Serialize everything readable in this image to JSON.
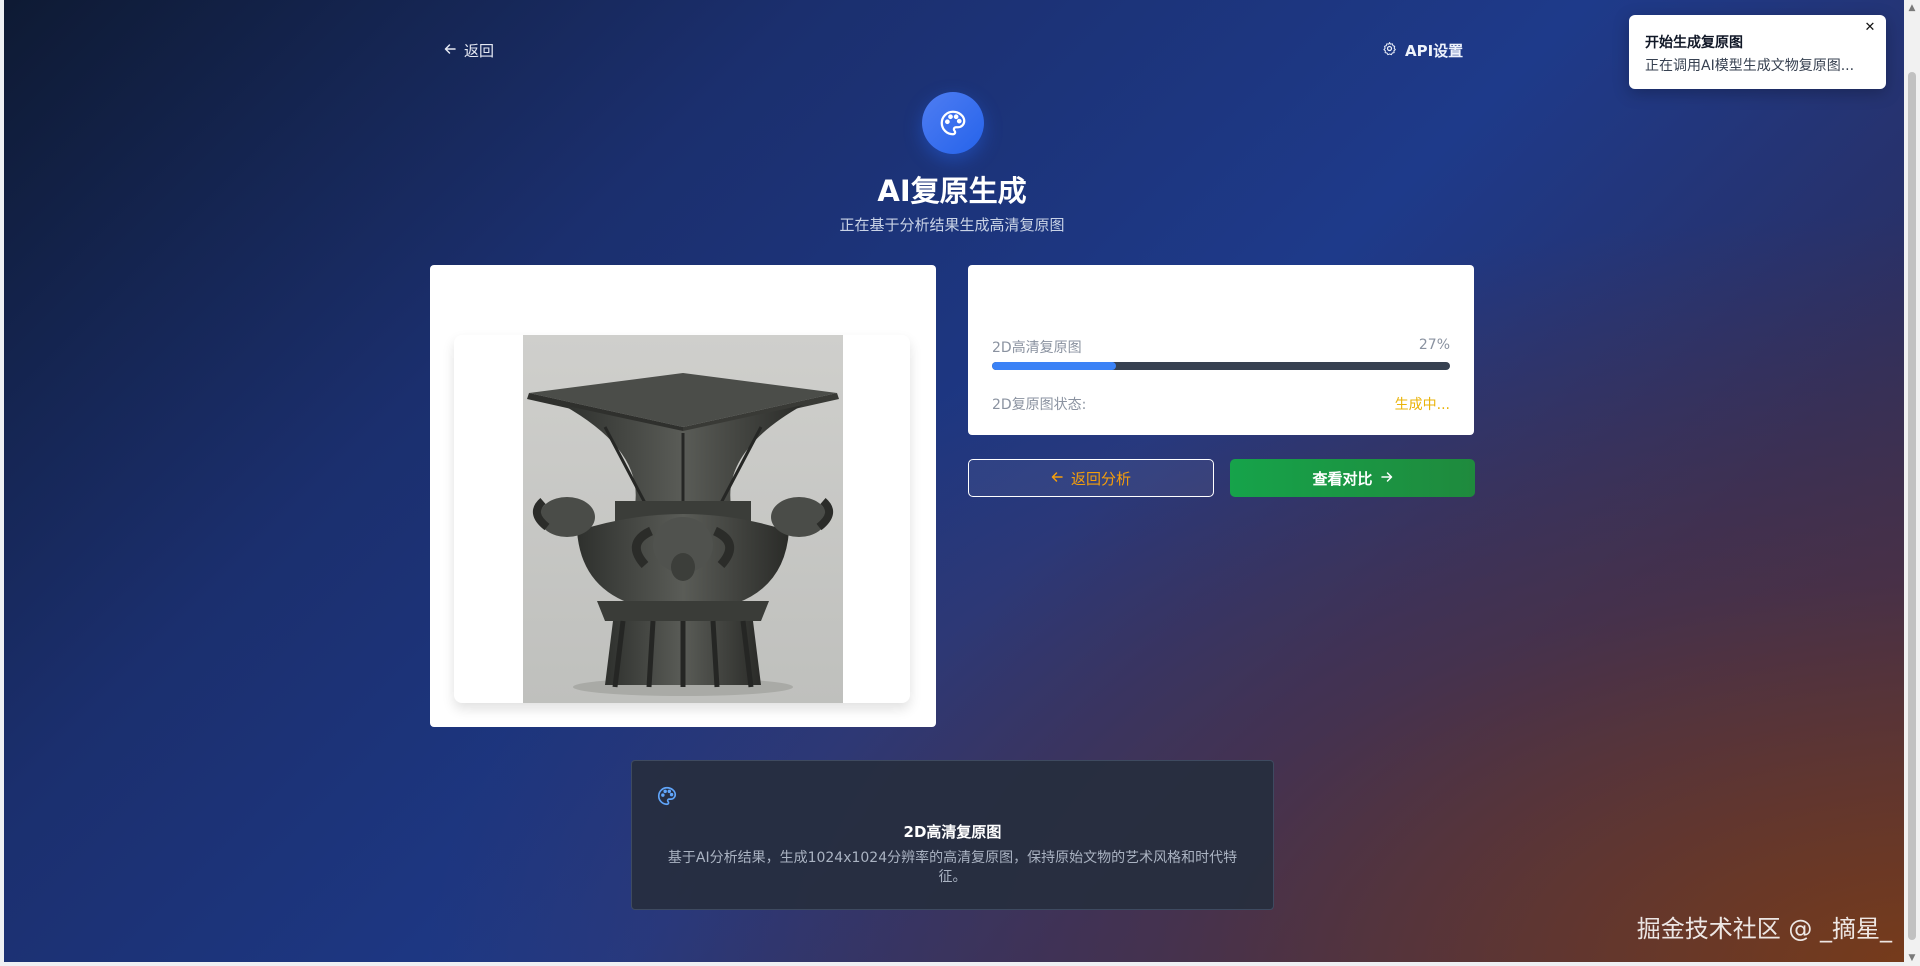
{
  "nav": {
    "back_label": "返回",
    "api_settings_label": "API设置"
  },
  "header": {
    "icon": "palette-icon",
    "title": "AI复原生成",
    "subtitle": "正在基于分析结果生成高清复原图"
  },
  "preview": {
    "image_subject": "bronze-zun-vessel"
  },
  "progress": {
    "label": "2D高清复原图",
    "percent_text": "27%",
    "percent_value": 27,
    "status_label": "2D复原图状态:",
    "status_value": "生成中...",
    "status_color": "#eab308",
    "bar_color": "#3b82f6"
  },
  "actions": {
    "back_analysis_label": "返回分析",
    "compare_label": "查看对比"
  },
  "info": {
    "icon": "palette-icon",
    "title": "2D高清复原图",
    "description": "基于AI分析结果，生成1024x1024分辨率的高清复原图，保持原始文物的艺术风格和时代特征。"
  },
  "toast": {
    "title": "开始生成复原图",
    "message": "正在调用AI模型生成文物复原图..."
  },
  "watermark": "掘金技术社区 @ _摘星_"
}
